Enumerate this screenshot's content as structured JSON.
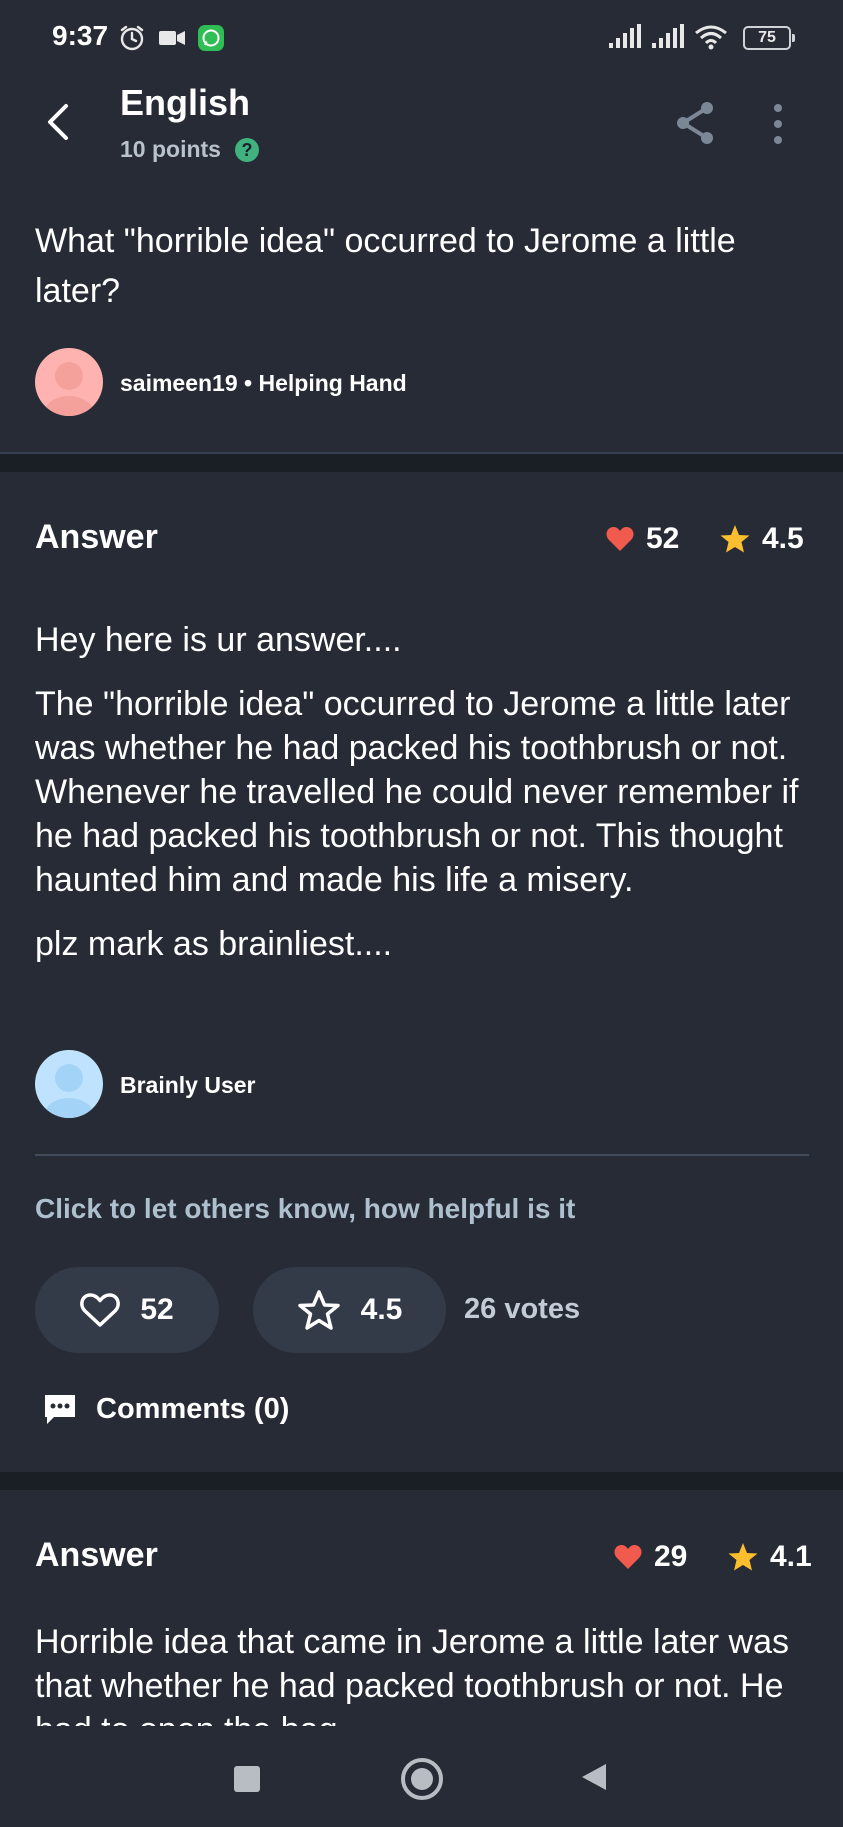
{
  "status_bar": {
    "time": "9:37",
    "battery": "75"
  },
  "header": {
    "subject": "English",
    "points": "10 points",
    "help_glyph": "?"
  },
  "question": {
    "text": "What \"horrible idea\" occurred to Jerome a little later?",
    "asker": "saimeen19 • Helping Hand"
  },
  "answer1": {
    "title": "Answer",
    "likes": "52",
    "rating": "4.5",
    "paragraphs": [
      "Hey here is ur answer....",
      "The \"horrible idea\" occurred to Jerome a little later was whether he had packed his toothbrush or not. Whenever he travelled he could never remember if he had packed his toothbrush or not. This thought haunted him and made his life a misery.",
      "plz mark as brainliest...."
    ],
    "author": "Brainly User",
    "prompt": "Click to let others know, how helpful is it",
    "like_button": "52",
    "rate_button": "4.5",
    "votes": "26 votes",
    "comments": "Comments (0)"
  },
  "answer2": {
    "title": "Answer",
    "likes": "29",
    "rating": "4.1",
    "text": "Horrible idea that came in Jerome a little later was that whether he had packed toothbrush or not. He had to open the bag"
  },
  "colors": {
    "background": "#262b35",
    "heart": "#f15b4e",
    "star": "#fbbe2e",
    "help": "#3fb27f"
  }
}
